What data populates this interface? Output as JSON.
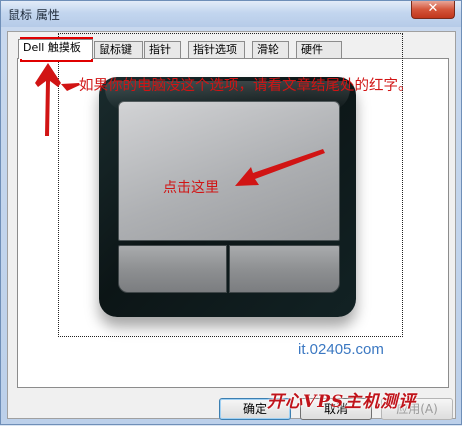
{
  "window": {
    "title": "鼠标 属性",
    "close_glyph": "✕"
  },
  "tabs": [
    {
      "label": "Dell 触摸板",
      "active": true
    },
    {
      "label": "鼠标键",
      "active": false
    },
    {
      "label": "指针",
      "active": false
    },
    {
      "label": "指针选项",
      "active": false
    },
    {
      "label": "滑轮",
      "active": false
    },
    {
      "label": "硬件",
      "active": false
    }
  ],
  "annotations": {
    "instruction": "如果你的电脑没这个选项，请看文章结尾处的红字。",
    "click_here": "点击这里",
    "color": "#d11414"
  },
  "watermark": "it.02405.com",
  "site_logo": "开心VPS主机测评",
  "buttons": {
    "ok": "确定",
    "cancel": "取消",
    "apply": "应用(A)"
  },
  "icons": {
    "window_icon": "mouse-icon",
    "close": "close-icon"
  }
}
